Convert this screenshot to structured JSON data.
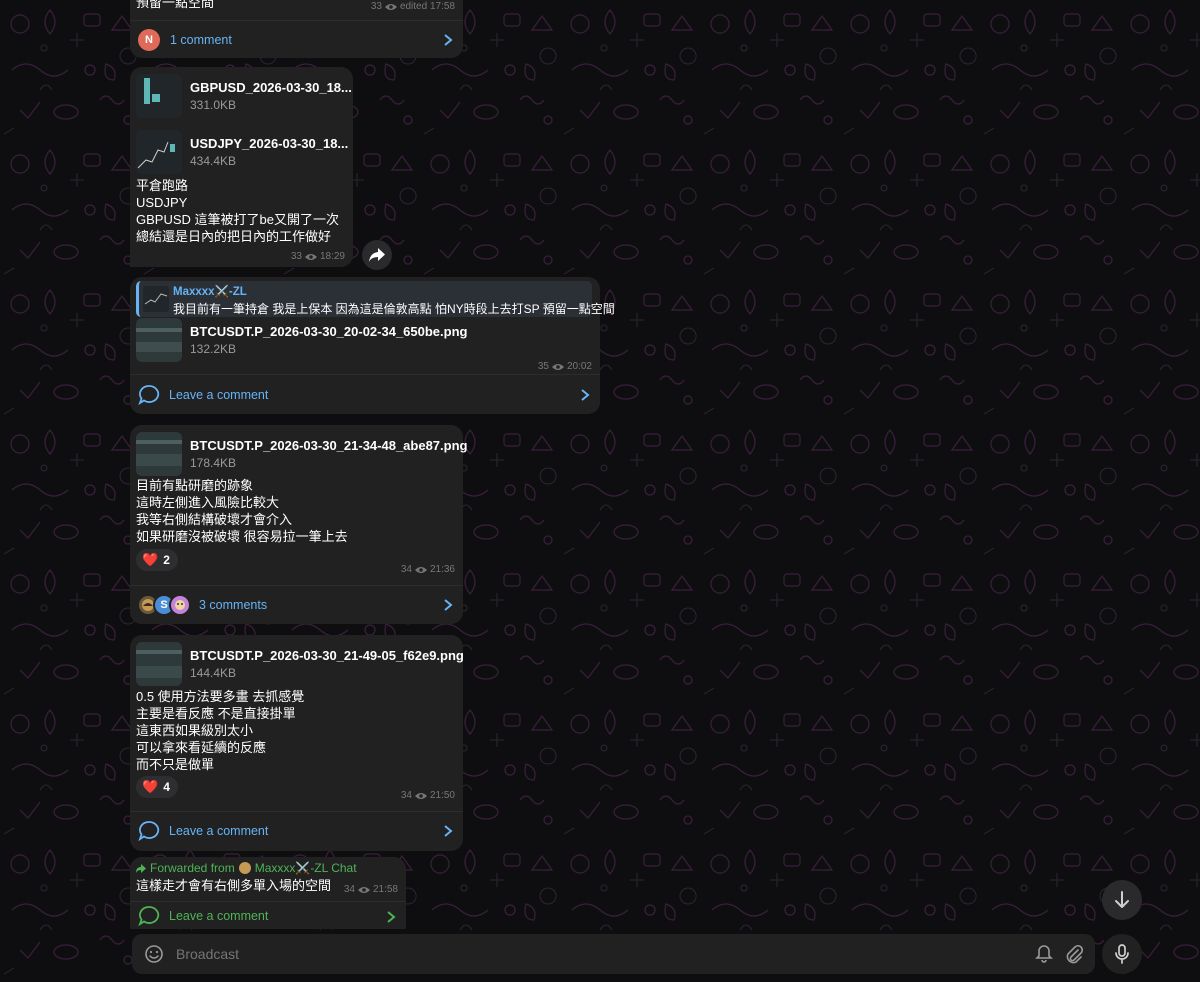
{
  "theme": {
    "accent": "#66b4f5",
    "green": "#4fb356",
    "bubble": "#212121",
    "background": "#0e0e10"
  },
  "top_post": {
    "partial_text": "預留一點空間",
    "views": "33",
    "edited_time": "edited 17:58",
    "comments": {
      "avatar_letter": "N",
      "avatar_color": "#e06a5a",
      "label": "1 comment",
      "icon": "chevron-right-icon"
    }
  },
  "post1": {
    "files": [
      {
        "name": "GBPUSD_2026-03-30_18...",
        "size": "331.0KB"
      },
      {
        "name": "USDJPY_2026-03-30_18...",
        "size": "434.4KB"
      }
    ],
    "text": "平倉跑路\nUSDJPY\nGBPUSD 這筆被打了be又開了一次\n總結還是日內的把日內的工作做好",
    "views": "33",
    "time": "18:29",
    "share_icon": "share-icon"
  },
  "post2": {
    "reply": {
      "author": "Maxxxx⚔️-ZL",
      "text": "我目前有一筆持倉 我是上保本 因為這是倫敦高點 怕NY時段上去打SP 預留一點空間"
    },
    "file": {
      "name": "BTCUSDT.P_2026-03-30_20-02-34_650be.png",
      "size": "132.2KB"
    },
    "views": "35",
    "time": "20:02",
    "comment_label": "Leave a comment"
  },
  "post3": {
    "file": {
      "name": "BTCUSDT.P_2026-03-30_21-34-48_abe87.png",
      "size": "178.4KB"
    },
    "text": "目前有點研磨的跡象\n這時左側進入風險比較大\n我等右側結構破壞才會介入\n如果研磨沒被破壞 很容易拉一筆上去",
    "reaction": {
      "emoji": "❤️",
      "count": "2"
    },
    "views": "34",
    "time": "21:36",
    "comments": {
      "avatars": [
        "",
        "S",
        ""
      ],
      "label": "3 comments"
    }
  },
  "post4": {
    "file": {
      "name": "BTCUSDT.P_2026-03-30_21-49-05_f62e9.png",
      "size": "144.4KB"
    },
    "text": "0.5 使用方法要多畫 去抓感覺\n主要是看反應 不是直接掛單\n這東西如果級別太小\n可以拿來看延續的反應\n而不只是做單",
    "reaction": {
      "emoji": "❤️",
      "count": "4"
    },
    "views": "34",
    "time": "21:50",
    "comment_label": "Leave a comment"
  },
  "post5": {
    "forwarded_prefix": "Forwarded from",
    "forwarded_from": "Maxxxx⚔️-ZL Chat",
    "text": "這樣走才會有右側多單入場的空間",
    "views": "34",
    "time": "21:58",
    "comment_label": "Leave a comment"
  },
  "composer": {
    "placeholder": "Broadcast",
    "icons": [
      "emoji-icon",
      "bell-icon",
      "attach-icon",
      "microphone-icon"
    ]
  },
  "scroll_down_icon": "arrow-down-icon"
}
